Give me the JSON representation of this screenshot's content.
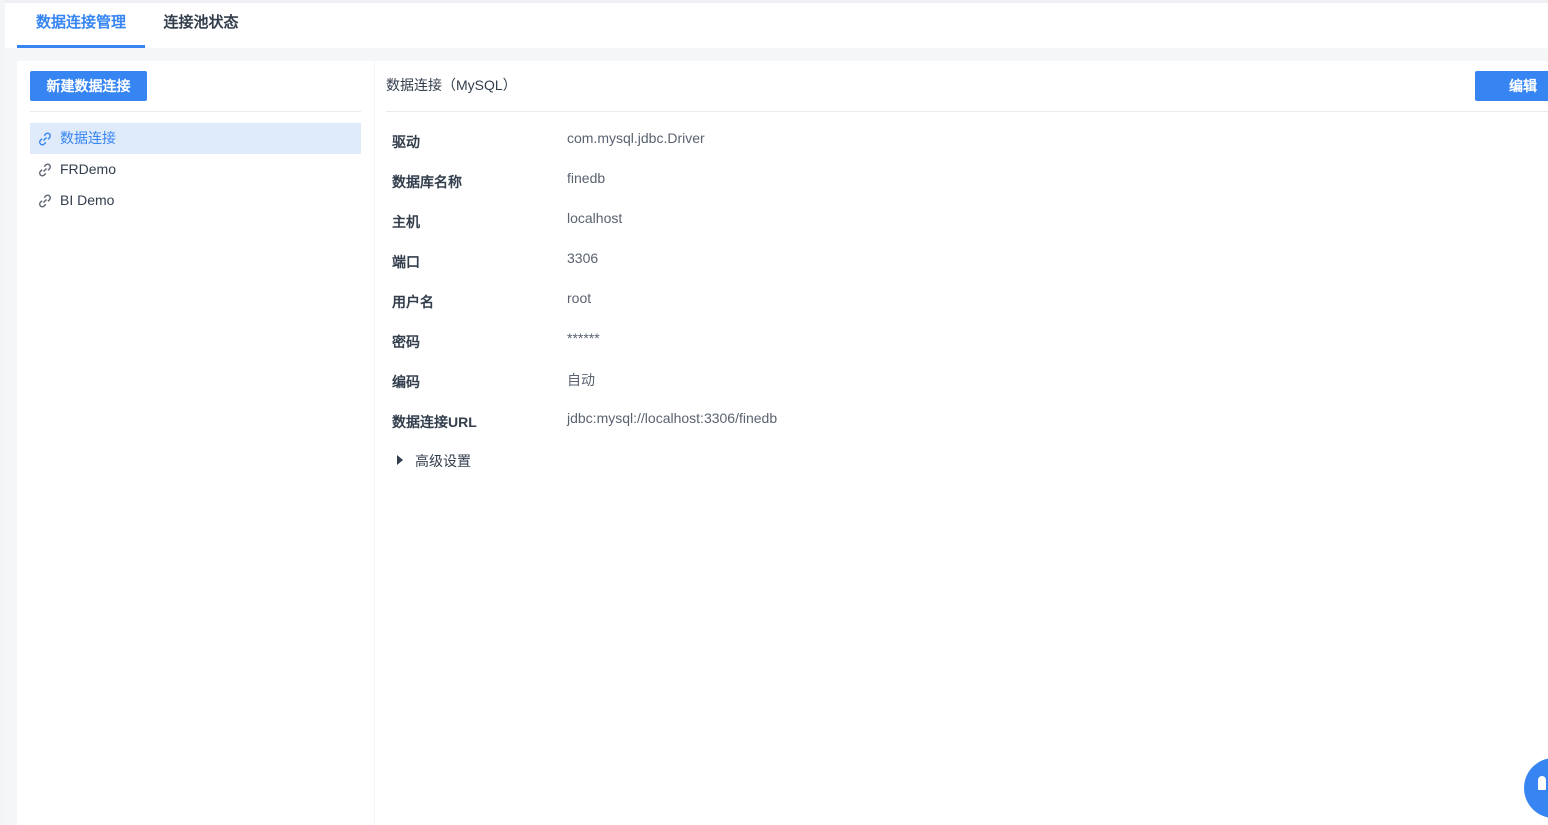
{
  "tabs": [
    {
      "label": "数据连接管理",
      "active": true
    },
    {
      "label": "连接池状态",
      "active": false
    }
  ],
  "left_panel": {
    "new_button_label": "新建数据连接",
    "connections": [
      {
        "name": "数据连接",
        "selected": true
      },
      {
        "name": "FRDemo",
        "selected": false
      },
      {
        "name": "BI Demo",
        "selected": false
      }
    ]
  },
  "detail": {
    "title": "数据连接（MySQL）",
    "edit_button_label": "编辑",
    "fields": [
      {
        "label": "驱动",
        "value": "com.mysql.jdbc.Driver"
      },
      {
        "label": "数据库名称",
        "value": "finedb"
      },
      {
        "label": "主机",
        "value": "localhost"
      },
      {
        "label": "端口",
        "value": "3306"
      },
      {
        "label": "用户名",
        "value": "root"
      },
      {
        "label": "密码",
        "value": "******"
      },
      {
        "label": "编码",
        "value": "自动"
      },
      {
        "label": "数据连接URL",
        "value": "jdbc:mysql://localhost:3306/finedb"
      }
    ],
    "advanced_label": "高级设置"
  },
  "icons": {
    "connection_item": "link-icon",
    "advanced_toggle": "caret-right-icon",
    "splitter": "drag-handle-icon",
    "help": "help-bubble-icon"
  },
  "colors": {
    "accent": "#3685f2",
    "selected_bg": "#dfeafb",
    "page_bg": "#f4f6f8",
    "text": "#333e4d"
  }
}
